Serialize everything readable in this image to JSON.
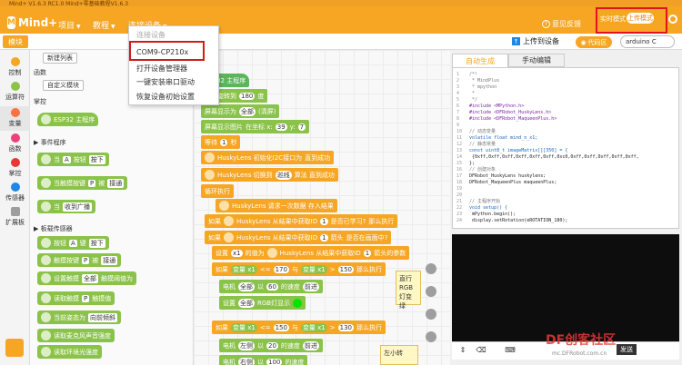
{
  "window": {
    "title": "Mind+ V1.6.3 RC1.0   Mind+零基础教程V1.6.3"
  },
  "brand": {
    "logo_text": "Mind+",
    "accent": "#f6a623",
    "highlight": "#d21a1a"
  },
  "menus": [
    {
      "label": "项目"
    },
    {
      "label": "教程"
    },
    {
      "label": "连接设备"
    }
  ],
  "header_right": {
    "feedback": "意见反馈",
    "mode_realtime": "实时模式",
    "mode_upload": "上传模式"
  },
  "toolbar": {
    "modules_tab": "模块",
    "upload_label": "上传到设备",
    "code_label": "代码区",
    "board_select": "arduino C"
  },
  "categories": [
    {
      "label": "控制",
      "color": "#f6a623"
    },
    {
      "label": "运算符",
      "color": "#8bc34a"
    },
    {
      "label": "变量",
      "color": "#ff7043"
    },
    {
      "label": "函数",
      "color": "#ec407a"
    },
    {
      "label": "掌控",
      "color": "#e53935"
    },
    {
      "label": "传感器",
      "color": "#1e88e5"
    },
    {
      "label": "扩展板",
      "color": "#9e9e9e"
    }
  ],
  "palette": {
    "new_list": "新建列表",
    "functions": "函数",
    "custom_module": "自定义模块",
    "mpython": "掌控",
    "esp32_main": "ESP32 主程序",
    "event_section": "▶ 事件程序",
    "blk_when_button": "当",
    "blk_button_a": "A",
    "blk_button_key": "按钮",
    "blk_pressed": "按下",
    "blk_touch": "当触摸按键",
    "blk_touch_p": "P",
    "blk_touched": "被",
    "blk_touch_state": "接通",
    "blk_when_received": "当",
    "blk_received": "收到广播",
    "sensor_section": "▶ 板载传感器",
    "blk_button": "按钮",
    "blk_btn_a": "A",
    "blk_btn_key": "键",
    "blk_btn_pressed": "按下",
    "blk_touch_key": "触摸按键",
    "blk_p": "P",
    "blk_pressed2": "被",
    "blk_connected": "接通",
    "blk_set_touch": "设置触摸",
    "blk_all": "全部",
    "blk_touch_thresh": "触摸阈值为",
    "blk_read_touch": "读取触摸",
    "blk_touch_val": "P",
    "blk_touch_read": "触摸值",
    "blk_shake": "当前姿态为",
    "blk_shake_val": "向前倾斜",
    "blk_sound": "读取麦克风声音强度",
    "blk_light": "读取环境光强度"
  },
  "dropdown": {
    "header": "连接设备",
    "port": "COM9-CP210x",
    "open_manager": "打开设备管理器",
    "install_driver": "一键安装串口驱动",
    "restore_device": "恢复设备初始设置"
  },
  "workspace": {
    "b_main": "ESP32 主程序",
    "b_screen_show": "屏幕显示",
    "b_rotate": "屏幕旋转到",
    "b_rotate_val": "180",
    "b_deg": "度",
    "b_screen_fill": "屏幕显示为",
    "b_all": "全部",
    "b_clear": "(清屏)",
    "b_show_text": "屏幕显示图片",
    "b_at": "在坐标 x:",
    "b_x": "39",
    "b_y_label": "y:",
    "b_y": "7",
    "b_wait": "等待",
    "b_wait_val": "1",
    "b_sec": "秒",
    "b_huskylens_init": "HuskyLens 初始化I2C接口为",
    "b_init_ok": "直到成功",
    "b_huskylens_switch": "HuskyLens 切换到",
    "b_line": "巡线",
    "b_algo_ok": "算法 直到成功",
    "b_loop": "循环执行",
    "b_request": "HuskyLens 请求一次数据 存入结果",
    "b_if": "如果",
    "b_from_result": "HuskyLens 从结果中获取ID",
    "b_id1": "1",
    "b_is_learned": "是否已学习?",
    "b_then": "那么执行",
    "b_get_arrow": "HuskyLens 从结果中获取ID",
    "b_arrow": "箭头",
    "b_in_screen": "是否在画面中?",
    "b_set_var": "设置",
    "b_var_x1": "x1",
    "b_value": "的值为",
    "b_arrow_param": "HuskyLens 从结果中获取ID",
    "b_arrow_param2": "箭头的参数",
    "b_if2": "如果",
    "b_var": "变量 x1",
    "b_lte": "<=",
    "b_170": "170",
    "b_and": "与",
    "b_var2": "变量 x1",
    "b_gt": ">",
    "b_150": "150",
    "b_then2": "那么执行",
    "b_motor": "电机",
    "b_all_m": "全部",
    "b_speed": "以",
    "b_60": "60",
    "b_speed_unit": "的速度",
    "b_fwd": "前进",
    "b_set_rgb": "设置",
    "b_all_rgb": "全部",
    "b_rgb": "RGB灯显示",
    "b_if3": "如果",
    "b_150b": "150",
    "b_130": "130",
    "b_then3": "那么执行",
    "b_motor2": "电机",
    "b_left": "左侧",
    "b_20": "20",
    "b_fwd2": "前进",
    "b_motor3": "电机",
    "b_right": "右侧",
    "b_100": "100",
    "b_tooltip1": "直行",
    "b_tooltip2": "RGB灯变绿",
    "b_tooltip3": "左小转"
  },
  "code": {
    "tab_auto": "自动生成",
    "tab_manual": "手动编辑",
    "lines": [
      {
        "n": "1",
        "t": "/*!",
        "c": "cmt"
      },
      {
        "n": "2",
        "t": " * MindPlus",
        "c": "cmt"
      },
      {
        "n": "3",
        "t": " * mpython",
        "c": "cmt"
      },
      {
        "n": "4",
        "t": " *",
        "c": "cmt"
      },
      {
        "n": "5",
        "t": " */",
        "c": "cmt"
      },
      {
        "n": "6",
        "t": "#include <MPython.h>",
        "c": "inc"
      },
      {
        "n": "7",
        "t": "#include <DFRobot_HuskyLens.h>",
        "c": "inc"
      },
      {
        "n": "8",
        "t": "#include <DFRobot_MaqueenPlus.h>",
        "c": "inc"
      },
      {
        "n": "9",
        "t": "",
        "c": "plain"
      },
      {
        "n": "10",
        "t": "// 动态变量",
        "c": "cmt"
      },
      {
        "n": "11",
        "t": "volatile float mind_n_x1;",
        "c": "kw"
      },
      {
        "n": "12",
        "t": "// 静态常量",
        "c": "cmt"
      },
      {
        "n": "13",
        "t": "const uint8_t imageMatrix[][350] = {",
        "c": "kw"
      },
      {
        "n": "14",
        "t": "  {0xff,0xff,0xff,0xff,0xff,0xff,0xc0,0xff,0xff,0xff,0xff,0xff,",
        "c": "plain"
      },
      {
        "n": "15",
        "t": "};",
        "c": "plain"
      },
      {
        "n": "16",
        "t": "// 创建对象",
        "c": "cmt"
      },
      {
        "n": "17",
        "t": "DFRobot_HuskyLens    huskylens;",
        "c": "plain"
      },
      {
        "n": "18",
        "t": "DFRobot_MaqueenPlus maqueenPlus;",
        "c": "plain"
      },
      {
        "n": "19",
        "t": "",
        "c": "plain"
      },
      {
        "n": "20",
        "t": "",
        "c": "plain"
      },
      {
        "n": "21",
        "t": "// 主程序开始",
        "c": "cmt"
      },
      {
        "n": "22",
        "t": "void setup() {",
        "c": "kw"
      },
      {
        "n": "23",
        "t": "  mPython.begin();",
        "c": "plain"
      },
      {
        "n": "24",
        "t": "  display.setRotation(eROTATION_180);",
        "c": "plain"
      }
    ]
  },
  "console": {
    "send_label": "发送"
  },
  "watermark": {
    "text": "DF创客社区",
    "sub": "mc.DFRobot.com.cn"
  }
}
